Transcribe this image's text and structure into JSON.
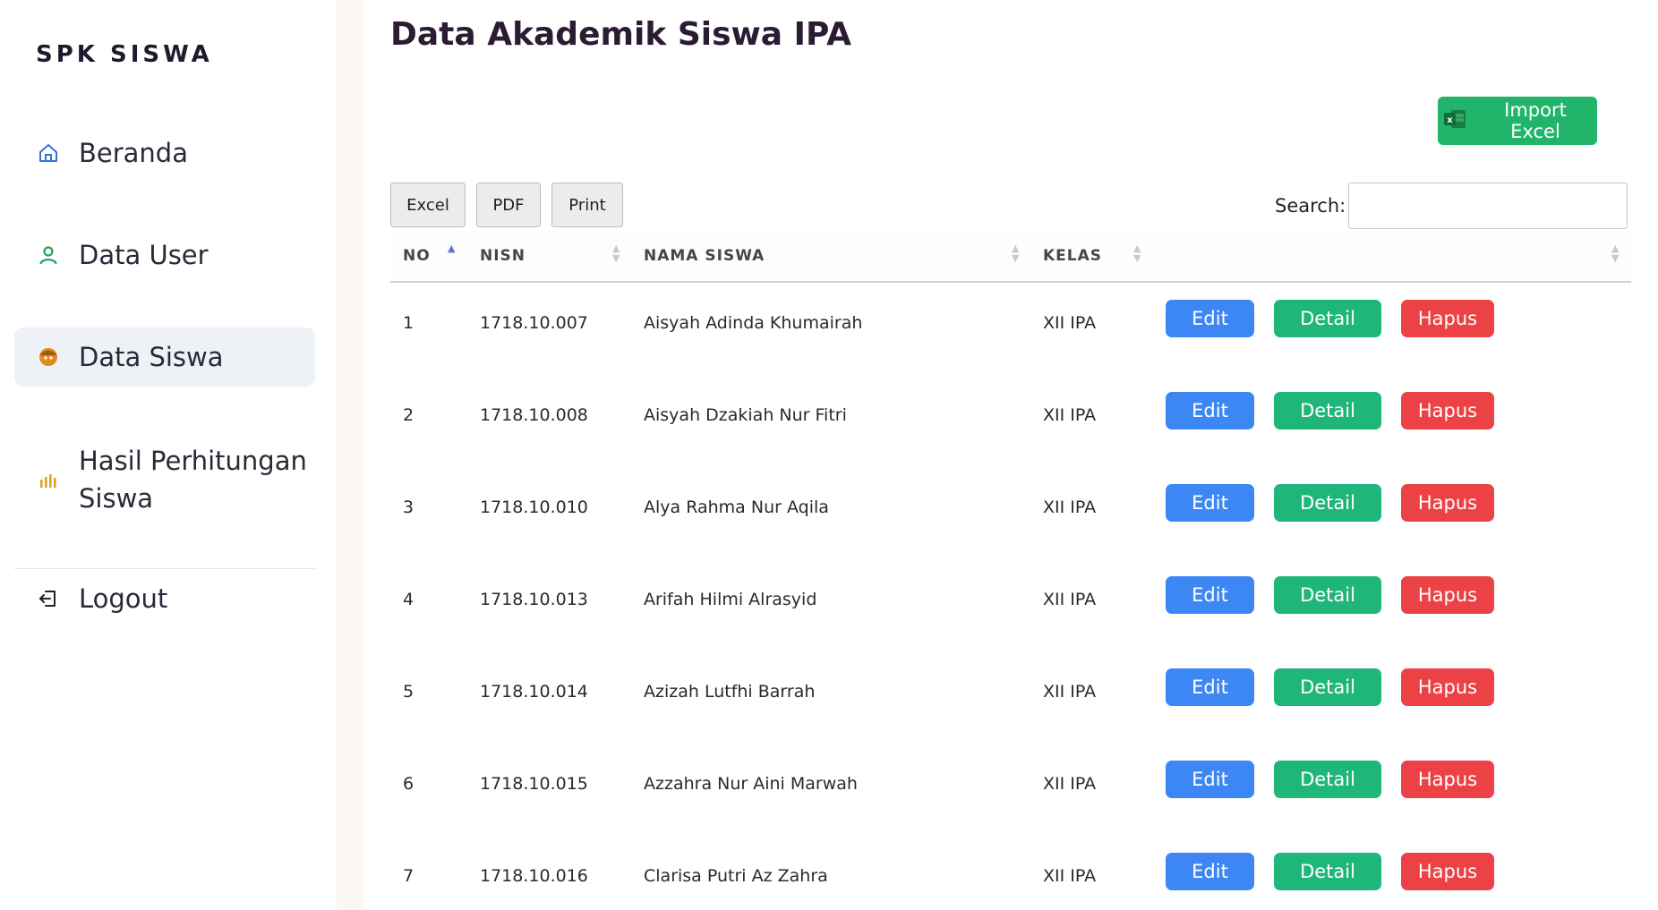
{
  "sidebar": {
    "brand": "SPK SISWA",
    "items": [
      {
        "label": "Beranda",
        "icon": "home-icon",
        "color": "#3a6fd8"
      },
      {
        "label": "Data User",
        "icon": "user-icon",
        "color": "#1fa65a"
      },
      {
        "label": "Data Siswa",
        "icon": "student-icon",
        "color": "#e08a1e",
        "active": true
      },
      {
        "label": "Hasil Perhitungan",
        "label2": "Siswa",
        "icon": "bar-chart-icon",
        "color": "#e0a31e"
      },
      {
        "label": "Logout",
        "icon": "logout-icon",
        "color": "#222222"
      }
    ]
  },
  "main": {
    "title": "Data Akademik Siswa IPA",
    "import_label": "Import Excel",
    "export_buttons": {
      "excel": "Excel",
      "pdf": "PDF",
      "print": "Print"
    },
    "search_label": "Search:",
    "search_value": "",
    "table": {
      "columns": {
        "no": "NO",
        "nisn": "NISN",
        "nama": "NAMA SISWA",
        "kelas": "KELAS"
      },
      "action_labels": {
        "edit": "Edit",
        "detail": "Detail",
        "hapus": "Hapus"
      },
      "rows": [
        {
          "no": "1",
          "nisn": "1718.10.007",
          "nama": "Aisyah Adinda Khumairah",
          "kelas": "XII IPA"
        },
        {
          "no": "2",
          "nisn": "1718.10.008",
          "nama": "Aisyah Dzakiah Nur Fitri",
          "kelas": "XII IPA"
        },
        {
          "no": "3",
          "nisn": "1718.10.010",
          "nama": "Alya Rahma Nur Aqila",
          "kelas": "XII IPA"
        },
        {
          "no": "4",
          "nisn": "1718.10.013",
          "nama": "Arifah Hilmi Alrasyid",
          "kelas": "XII IPA"
        },
        {
          "no": "5",
          "nisn": "1718.10.014",
          "nama": "Azizah Lutfhi Barrah",
          "kelas": "XII IPA"
        },
        {
          "no": "6",
          "nisn": "1718.10.015",
          "nama": "Azzahra Nur Aini Marwah",
          "kelas": "XII IPA"
        },
        {
          "no": "7",
          "nisn": "1718.10.016",
          "nama": "Clarisa Putri Az Zahra",
          "kelas": "XII IPA"
        }
      ]
    }
  },
  "colors": {
    "edit": "#3d87f5",
    "detail": "#1fb67a",
    "hapus": "#ec4245",
    "import": "#21b56c"
  }
}
